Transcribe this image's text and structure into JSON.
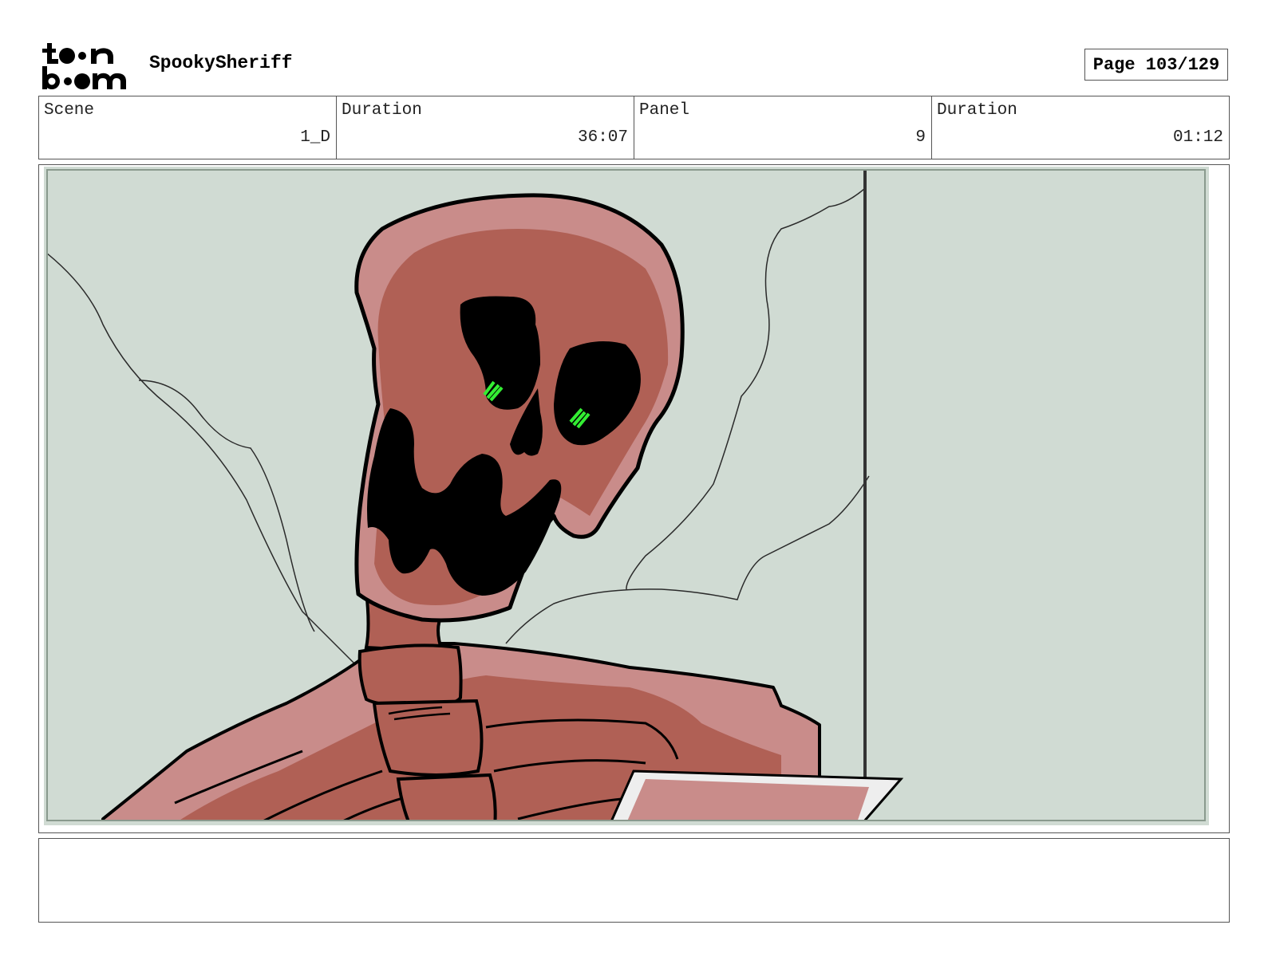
{
  "header": {
    "logo_text": [
      "to•n",
      "b•om"
    ],
    "project_title": "SpookySheriff",
    "page_label": "Page 103/129"
  },
  "info": {
    "scene_label": "Scene",
    "scene_value": "1_D",
    "scene_duration_label": "Duration",
    "scene_duration_value": "36:07",
    "panel_label": "Panel",
    "panel_value": "9",
    "panel_duration_label": "Duration",
    "panel_duration_value": "01:12"
  },
  "colors": {
    "background": "#d0dbd3",
    "skull_light": "#c98c8a",
    "skull_dark": "#b06055",
    "eye_glow": "#33ee33",
    "outline": "#000000"
  },
  "notes": {
    "text": ""
  }
}
